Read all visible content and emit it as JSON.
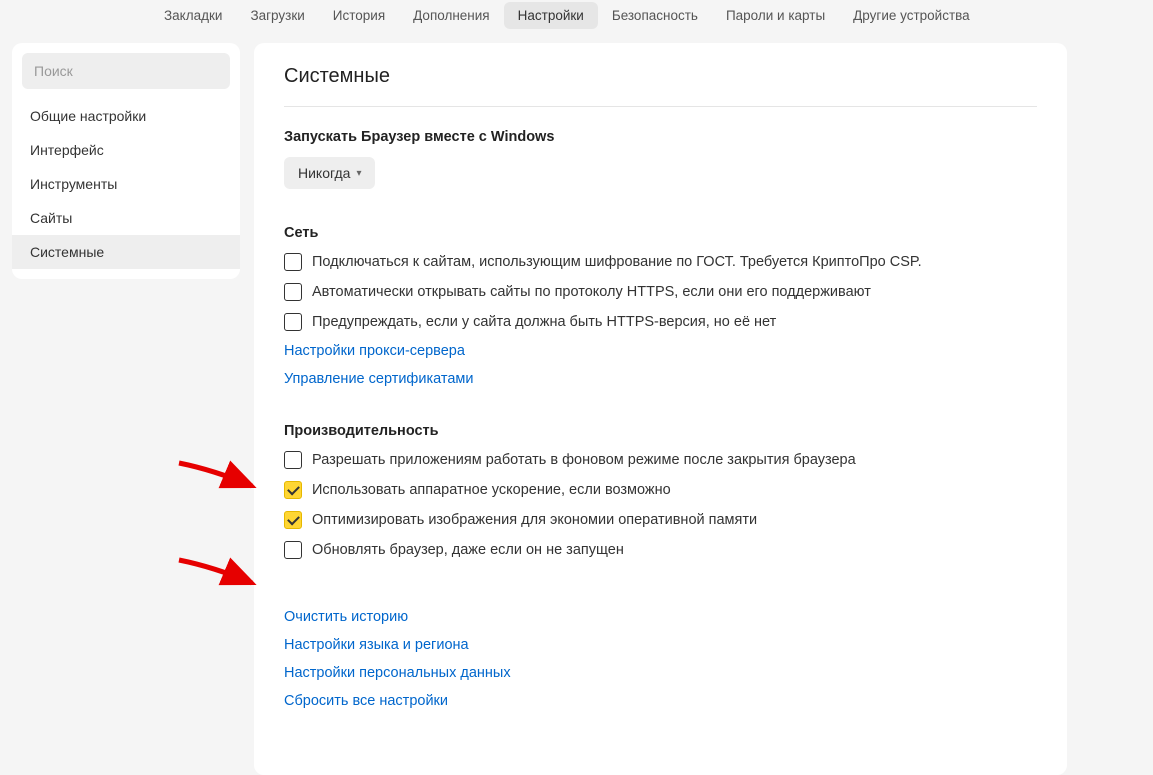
{
  "topNav": {
    "items": [
      {
        "label": "Закладки",
        "active": false
      },
      {
        "label": "Загрузки",
        "active": false
      },
      {
        "label": "История",
        "active": false
      },
      {
        "label": "Дополнения",
        "active": false
      },
      {
        "label": "Настройки",
        "active": true
      },
      {
        "label": "Безопасность",
        "active": false
      },
      {
        "label": "Пароли и карты",
        "active": false
      },
      {
        "label": "Другие устройства",
        "active": false
      }
    ]
  },
  "sidebar": {
    "searchPlaceholder": "Поиск",
    "items": [
      {
        "label": "Общие настройки",
        "active": false
      },
      {
        "label": "Интерфейс",
        "active": false
      },
      {
        "label": "Инструменты",
        "active": false
      },
      {
        "label": "Сайты",
        "active": false
      },
      {
        "label": "Системные",
        "active": true
      }
    ]
  },
  "content": {
    "title": "Системные",
    "startup": {
      "label": "Запускать Браузер вместе с Windows",
      "dropdownValue": "Никогда"
    },
    "network": {
      "heading": "Сеть",
      "checks": [
        {
          "checked": false,
          "label": "Подключаться к сайтам, использующим шифрование по ГОСТ. Требуется КриптоПро CSP."
        },
        {
          "checked": false,
          "label": "Автоматически открывать сайты по протоколу HTTPS, если они его поддерживают"
        },
        {
          "checked": false,
          "label": "Предупреждать, если у сайта должна быть HTTPS-версия, но её нет"
        }
      ],
      "links": [
        "Настройки прокси-сервера",
        "Управление сертификатами"
      ]
    },
    "performance": {
      "heading": "Производительность",
      "checks": [
        {
          "checked": false,
          "label": "Разрешать приложениям работать в фоновом режиме после закрытия браузера"
        },
        {
          "checked": true,
          "label": "Использовать аппаратное ускорение, если возможно"
        },
        {
          "checked": true,
          "label": "Оптимизировать изображения для экономии оперативной памяти"
        },
        {
          "checked": false,
          "label": "Обновлять браузер, даже если он не запущен"
        }
      ]
    },
    "bottomLinks": [
      "Очистить историю",
      "Настройки языка и региона",
      "Настройки персональных данных",
      "Сбросить все настройки"
    ]
  }
}
